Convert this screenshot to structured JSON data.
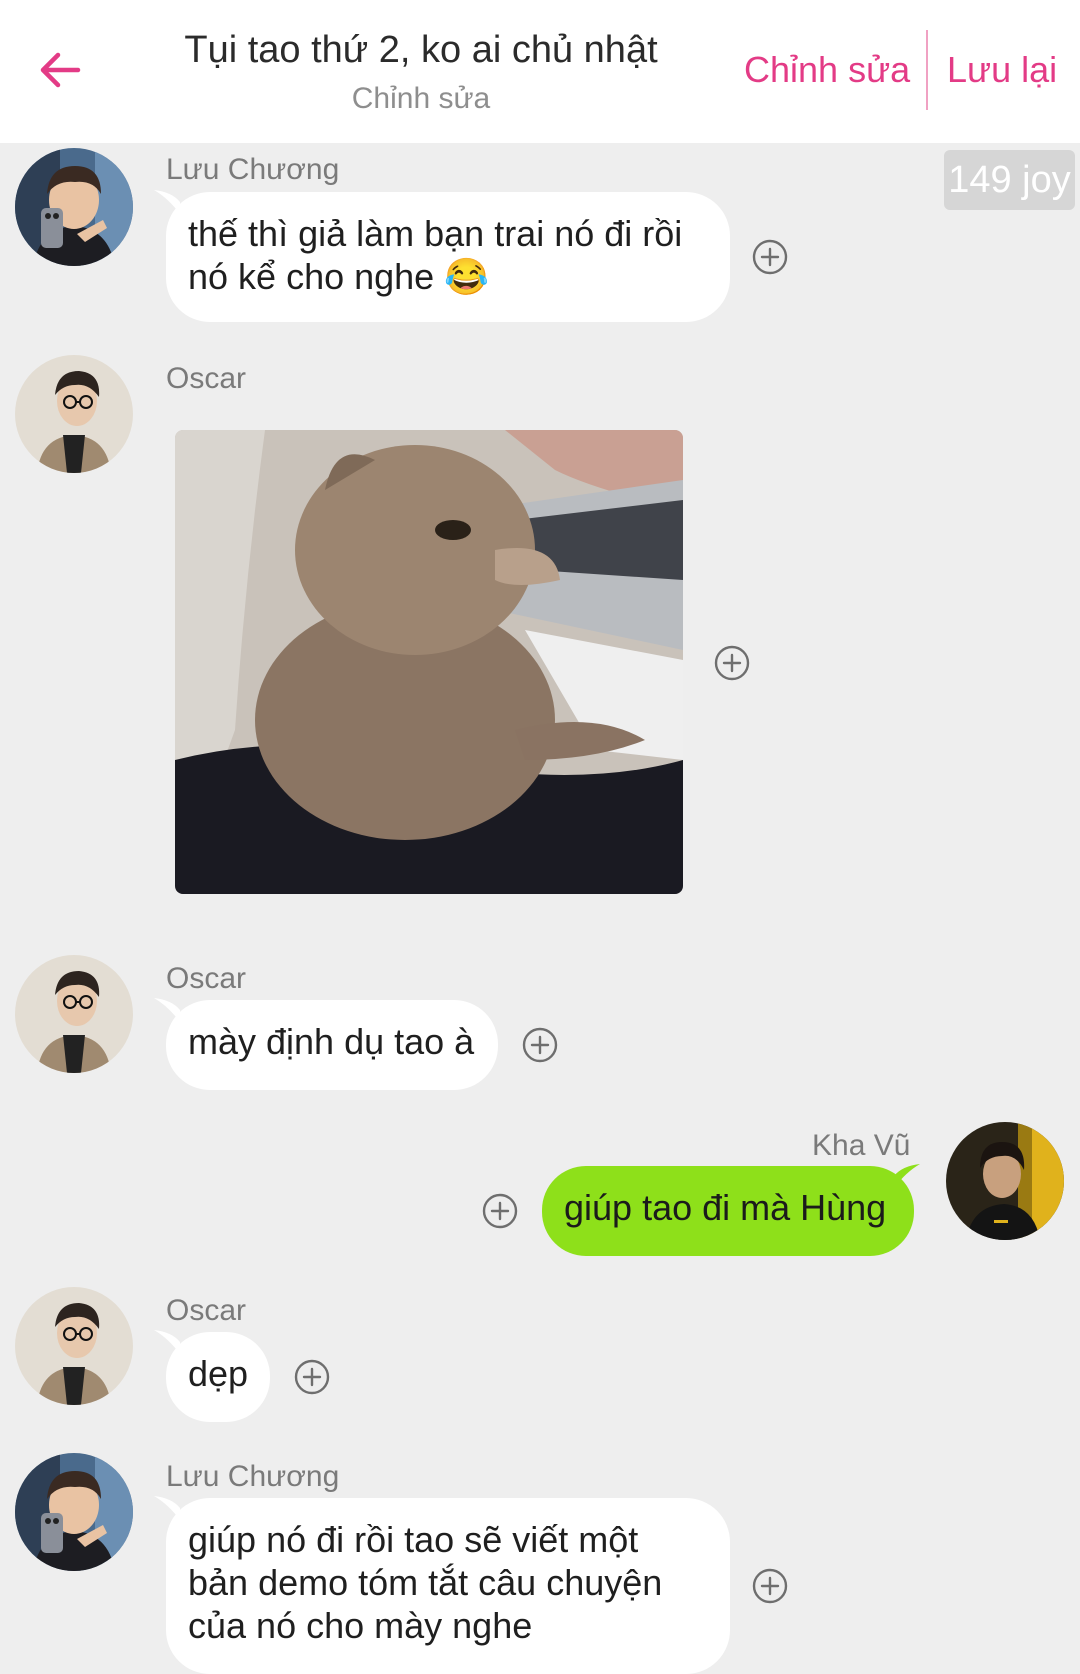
{
  "header": {
    "title": "Tụi tao thứ 2, ko ai chủ nhật",
    "subtitle": "Chỉnh sửa",
    "edit_label": "Chỉnh sửa",
    "save_label": "Lưu lại",
    "accent_color": "#e33b86"
  },
  "joy": {
    "label": "149 joy"
  },
  "messages": [
    {
      "sender": "Lưu Chương",
      "type": "text",
      "side": "left",
      "lines": [
        "thế thì giả làm bạn trai nó đi rồi",
        "nó kể cho nghe"
      ],
      "emoji": "😂"
    },
    {
      "sender": "Oscar",
      "type": "image",
      "side": "left",
      "image_alt": "cat sitting at laptop"
    },
    {
      "sender": "Oscar",
      "type": "text",
      "side": "left",
      "lines": [
        "mày định dụ tao à"
      ]
    },
    {
      "sender": "Kha Vũ",
      "type": "text",
      "side": "right",
      "lines": [
        "giúp tao đi mà Hùng"
      ]
    },
    {
      "sender": "Oscar",
      "type": "text",
      "side": "left",
      "lines": [
        "dẹp"
      ]
    },
    {
      "sender": "Lưu Chương",
      "type": "text",
      "side": "left",
      "lines": [
        "giúp nó đi rồi tao sẽ viết một",
        "bản demo tóm tắt câu chuyện",
        "của nó cho mày nghe"
      ]
    }
  ],
  "icons": {
    "back": "arrow-left-icon",
    "react": "plus-circle-icon"
  },
  "colors": {
    "background": "#eeeeee",
    "mine_bubble": "#8ee01a",
    "other_bubble": "#ffffff"
  }
}
